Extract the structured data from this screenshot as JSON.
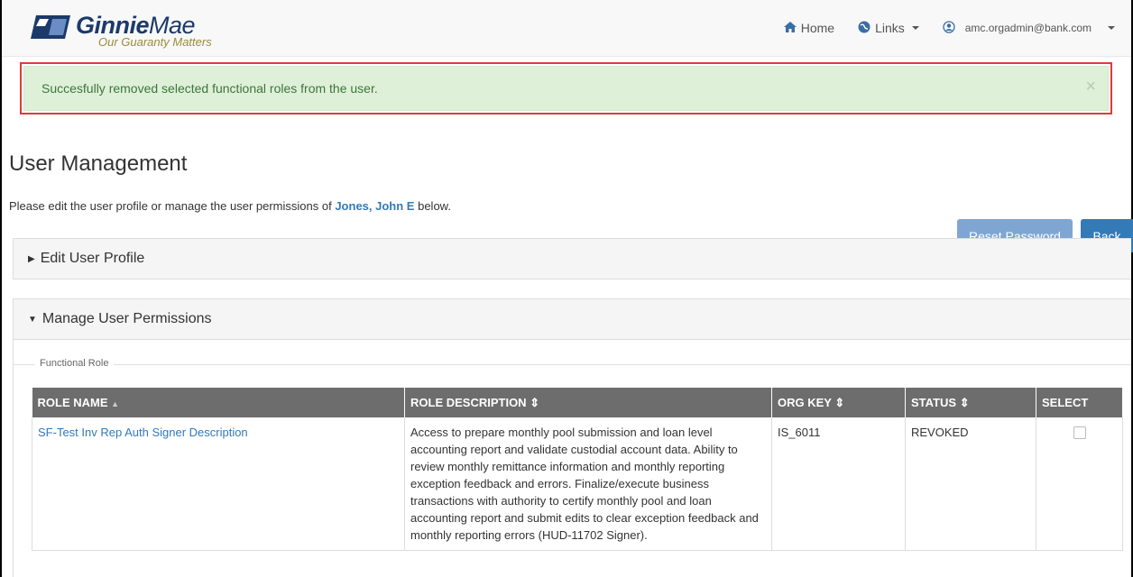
{
  "brand": {
    "name_bold": "Ginnie",
    "name_light": "Mae",
    "tagline": "Our Guaranty Matters"
  },
  "nav": {
    "home": "Home",
    "links": "Links",
    "user_email": "amc.orgadmin@bank.com"
  },
  "alert": {
    "message": "Succesfully removed selected functional roles from the user.",
    "close": "×"
  },
  "page": {
    "title": "User Management",
    "intro_before": "Please edit the user profile or manage the user permissions of",
    "user_name": "Jones, John E",
    "intro_after": "below.",
    "reset_password": "Reset Password",
    "back": "Back"
  },
  "panels": {
    "edit_profile": "Edit User Profile",
    "manage_permissions": "Manage User Permissions"
  },
  "functional_role": {
    "legend": "Functional Role",
    "columns": [
      "ROLE NAME",
      "ROLE DESCRIPTION",
      "ORG KEY",
      "STATUS",
      "SELECT"
    ],
    "rows": [
      {
        "role_name": "SF-Test Inv Rep Auth Signer Description",
        "description": "Access to prepare monthly pool submission and loan level accounting report and validate custodial account data. Ability to review monthly remittance information and monthly reporting exception feedback and errors. Finalize/execute business transactions with authority to certify monthly pool and loan accounting report and submit edits to clear exception feedback and monthly reporting errors (HUD-11702 Signer).",
        "org_key": "IS_6011",
        "status": "REVOKED",
        "selected": false
      }
    ]
  },
  "colors": {
    "alert_bg": "#dff0d8",
    "alert_text": "#3c763d",
    "highlight_border": "#e2393a",
    "primary": "#337ab7",
    "table_header": "#6d6d6d"
  }
}
